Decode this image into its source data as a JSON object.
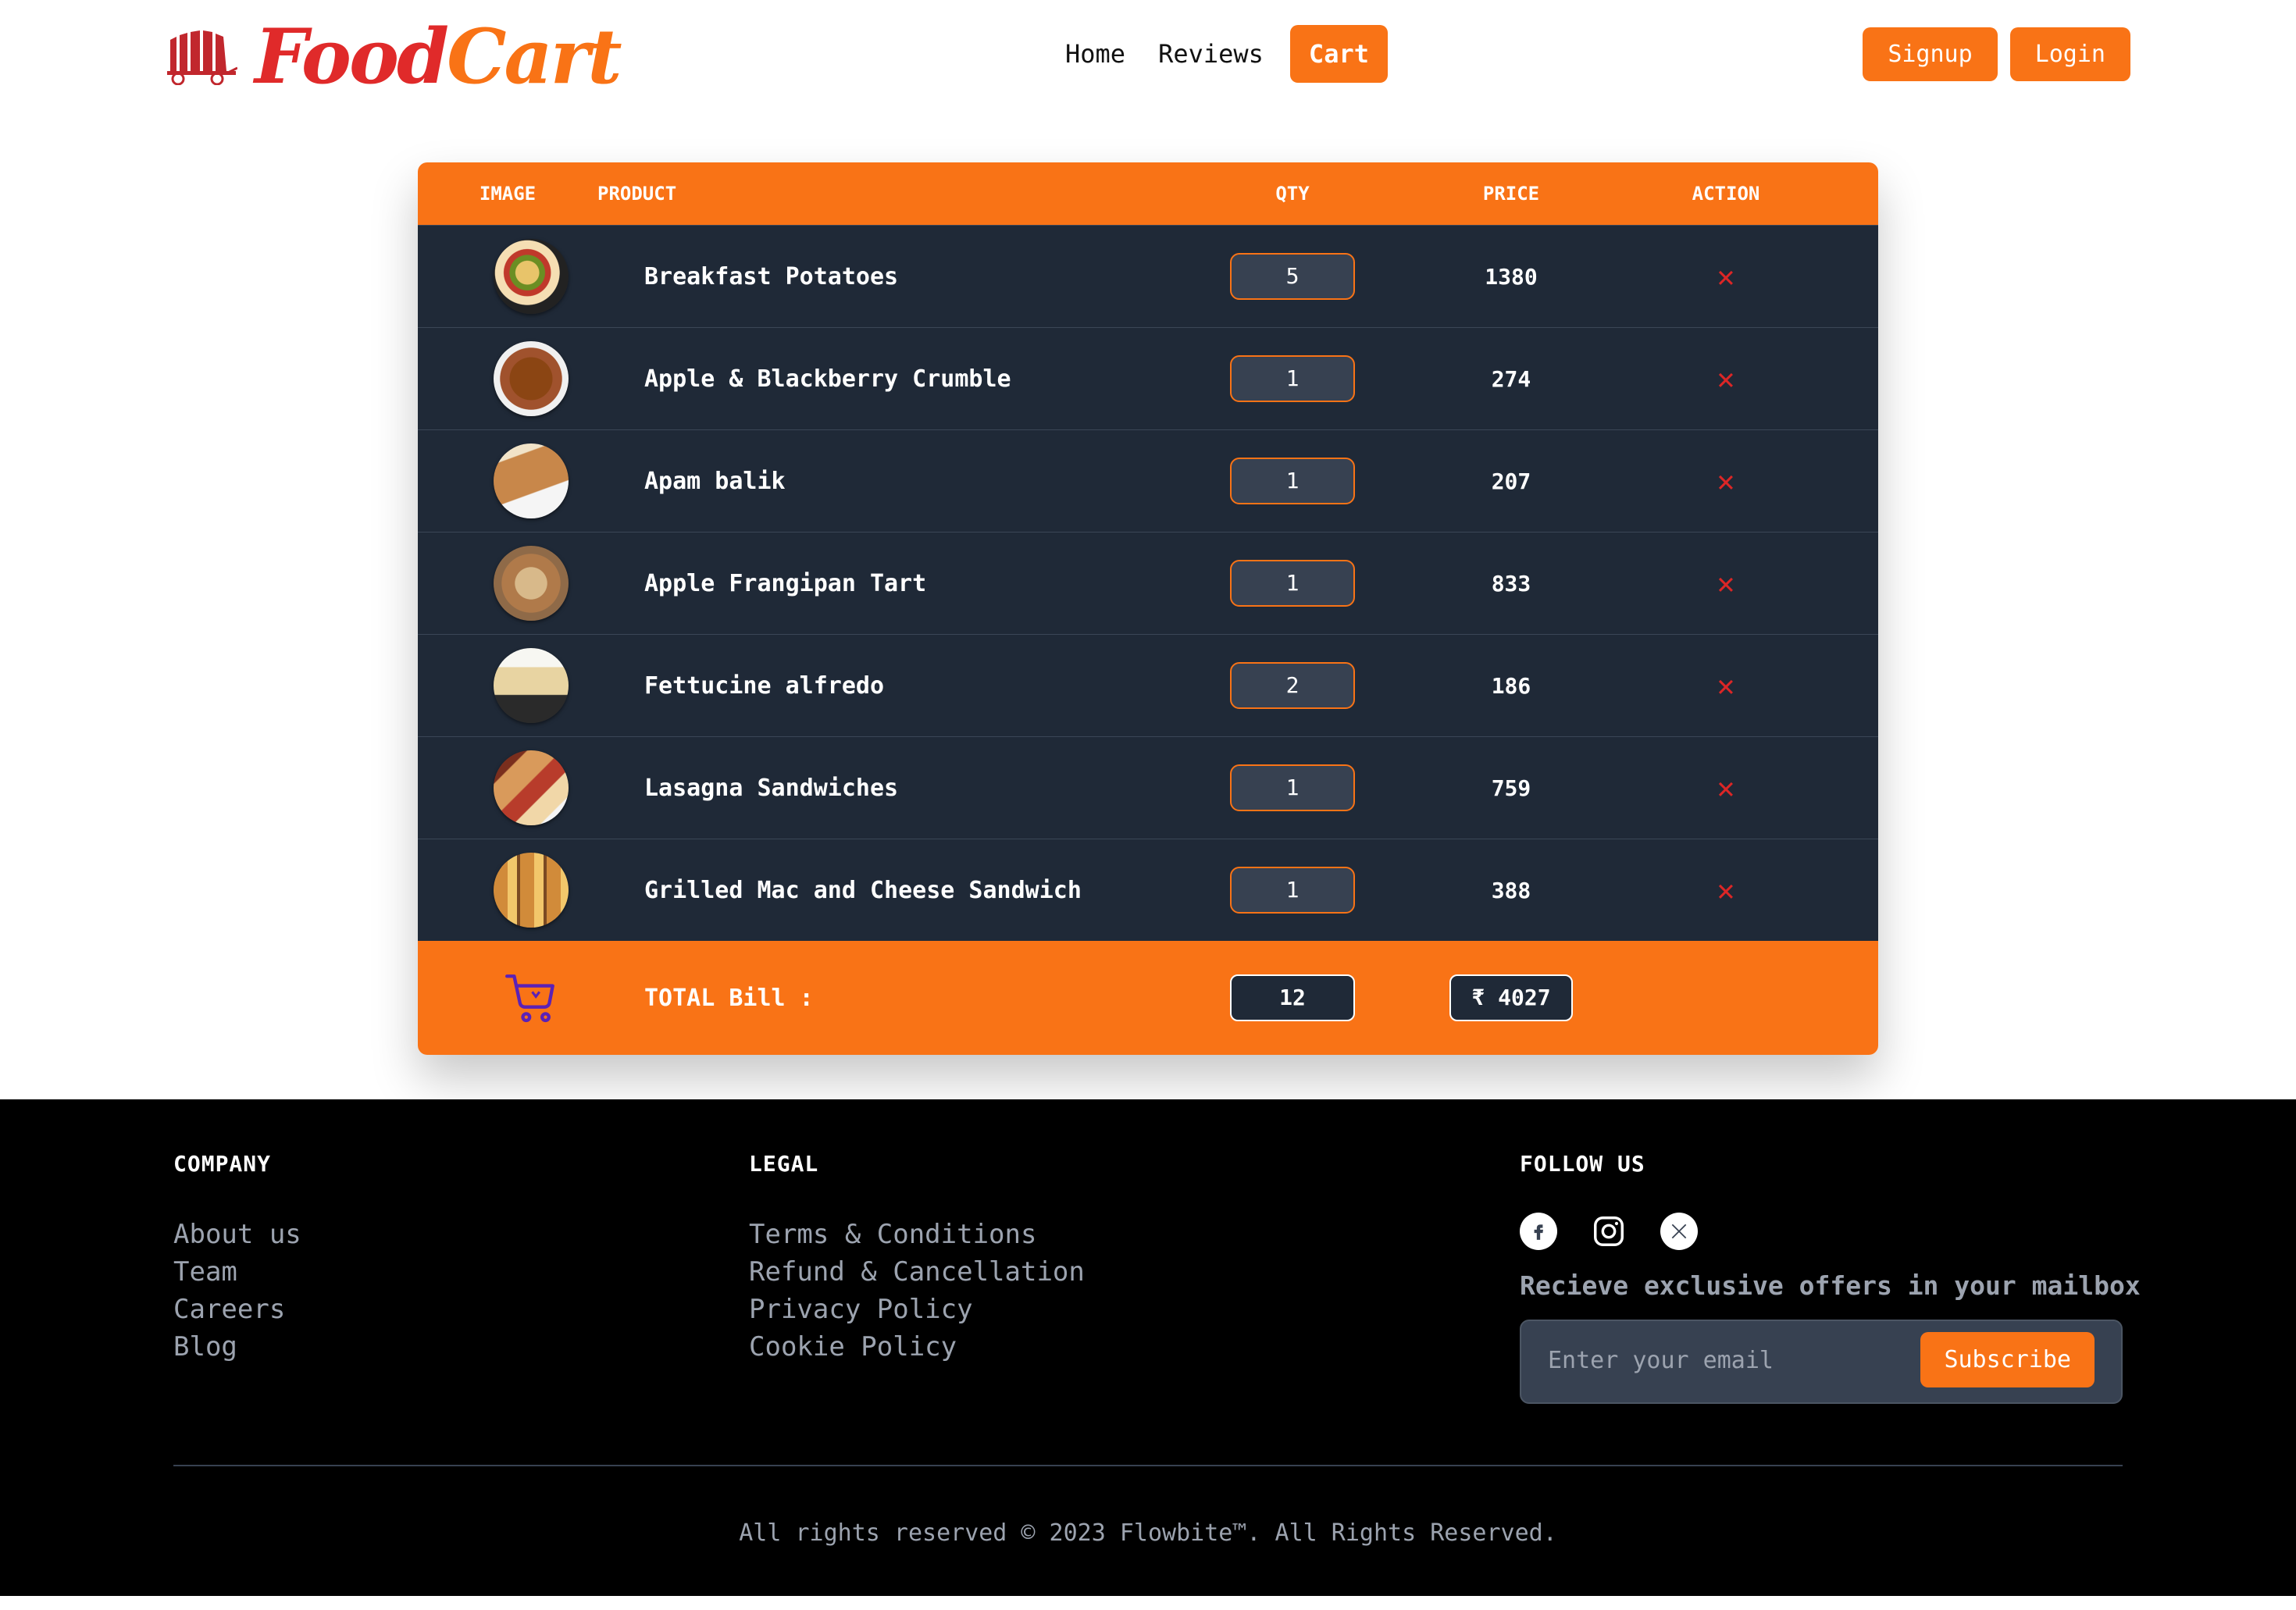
{
  "brand": {
    "name_part1": "Food",
    "name_part2": "Cart",
    "color_red": "#e02a2a",
    "color_orange": "#f97316"
  },
  "nav": {
    "items": [
      "Home",
      "Reviews",
      "Cart"
    ],
    "active": "Cart"
  },
  "auth": {
    "signup": "Signup",
    "login": "Login"
  },
  "cart": {
    "headers": {
      "image": "IMAGE",
      "product": "PRODUCT",
      "qty": "QTY",
      "price": "PRICE",
      "action": "ACTION"
    },
    "items": [
      {
        "name": "Breakfast Potatoes",
        "qty": "5",
        "price": "1380"
      },
      {
        "name": "Apple & Blackberry Crumble",
        "qty": "1",
        "price": "274"
      },
      {
        "name": "Apam balik",
        "qty": "1",
        "price": "207"
      },
      {
        "name": "Apple Frangipan Tart",
        "qty": "1",
        "price": "833"
      },
      {
        "name": "Fettucine alfredo",
        "qty": "2",
        "price": "186"
      },
      {
        "name": "Lasagna Sandwiches",
        "qty": "1",
        "price": "759"
      },
      {
        "name": "Grilled Mac and Cheese Sandwich",
        "qty": "1",
        "price": "388"
      }
    ],
    "remove_icon": "close-icon",
    "total": {
      "label": "TOTAL Bill :",
      "qty": "12",
      "amount": "₹ 4027",
      "icon": "shopping-cart-icon"
    }
  },
  "footer": {
    "company": {
      "heading": "COMPANY",
      "links": [
        "About us",
        "Team",
        "Careers",
        "Blog"
      ]
    },
    "legal": {
      "heading": "LEGAL",
      "links": [
        "Terms & Conditions",
        "Refund & Cancellation",
        "Privacy Policy",
        "Cookie Policy"
      ]
    },
    "follow": {
      "heading": "FOLLOW US",
      "icons": [
        "facebook-icon",
        "instagram-icon",
        "x-twitter-icon"
      ],
      "offer_text": "Recieve exclusive offers in your mailbox",
      "email_placeholder": "Enter your email",
      "subscribe": "Subscribe"
    },
    "copyright": "All rights reserved © 2023 Flowbite™. All Rights Reserved."
  }
}
